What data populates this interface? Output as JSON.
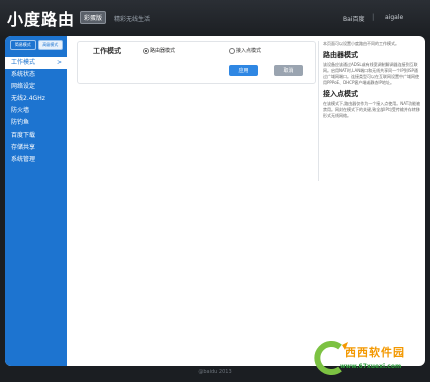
{
  "header": {
    "logo": "小度路由",
    "badge": "彩蛋版",
    "slogan": "精彩无线生活",
    "brand_baidu": "Bai百度",
    "brand_sep": "|",
    "brand_aigale": "aigale"
  },
  "sidebar": {
    "mode_simple": "简易模式",
    "mode_advanced": "高级模式",
    "items": [
      {
        "label": "工作模式",
        "active": true
      },
      {
        "label": "系统状态"
      },
      {
        "label": "网络设定"
      },
      {
        "label": "无线2.4GHz"
      },
      {
        "label": "防火墙"
      },
      {
        "label": "防钓鱼"
      },
      {
        "label": "百度下载"
      },
      {
        "label": "存储共享"
      },
      {
        "label": "系统管理"
      }
    ]
  },
  "form": {
    "label": "工作模式",
    "option_router": "路由器模式",
    "option_ap": "接入点模式",
    "selected": "路由器模式",
    "apply": "应用",
    "cancel": "取消"
  },
  "help": {
    "intro": "本页面可以设置小度路由不同的工作模式。",
    "router_title": "路由器模式",
    "router_text": "该设备应该通过ADSL或有线宽调制解调器连接到互联网。启用NAT时,LAN端口和无线共享同一个IP到ISP通过广域网端口。连接类型可以在互联网设置中广域网使用PPPoE、DHCP客户端或静态IP地址。",
    "ap_title": "接入点模式",
    "ap_text": "在该模式下,路由器仅作为一个接入点使用。NAT功能被禁用。网封在模式下的关键,致全部IP均受传输并存转移形式无线网络。"
  },
  "footer": {
    "copyright": "@baidu 2013"
  },
  "watermark": {
    "title": "西西软件园",
    "url": "www.67xuexi.com"
  },
  "colors": {
    "accent": "#1d74d0",
    "header_bg": "#2b2f35",
    "button_apply": "#2f87e3",
    "button_cancel": "#9aa4b0"
  }
}
